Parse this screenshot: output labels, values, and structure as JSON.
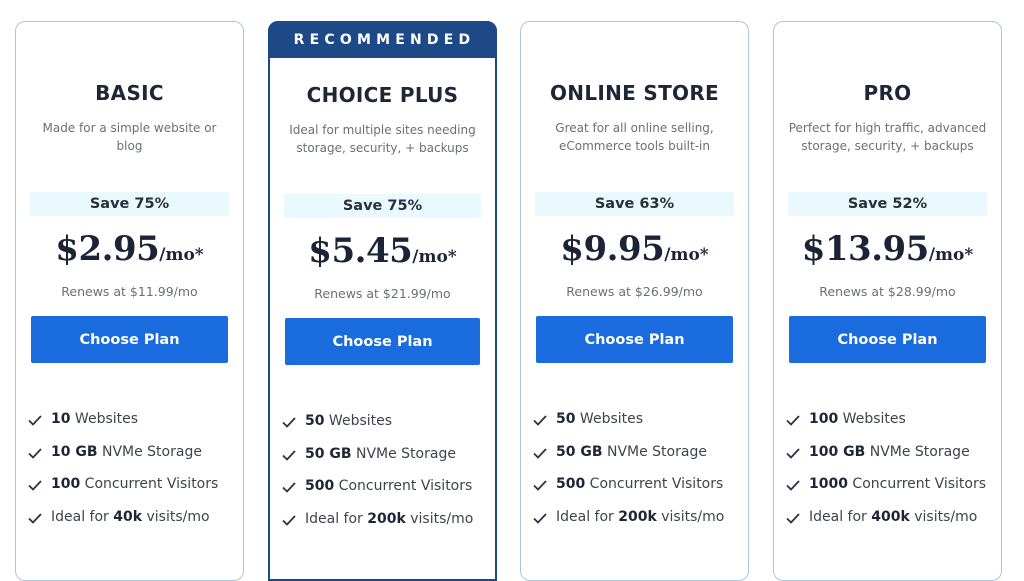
{
  "recommended_label": "RECOMMENDED",
  "plans": [
    {
      "name": "BASIC",
      "description": "Made for a simple website or blog",
      "save": "Save 75%",
      "price": "$2.95",
      "per": "/mo*",
      "renews": "Renews at $11.99/mo",
      "button": "Choose Plan",
      "features": [
        {
          "bold": "10",
          "text": " Websites"
        },
        {
          "bold": "10 GB",
          "text": " NVMe Storage"
        },
        {
          "bold": "100",
          "text": " Concurrent Visitors"
        },
        {
          "pre": "Ideal for ",
          "bold": "40k",
          "text": " visits/mo"
        }
      ]
    },
    {
      "name": "CHOICE PLUS",
      "description": "Ideal for multiple sites needing storage, security, + backups",
      "save": "Save 75%",
      "price": "$5.45",
      "per": "/mo*",
      "renews": "Renews at $21.99/mo",
      "button": "Choose Plan",
      "recommended": true,
      "features": [
        {
          "bold": "50",
          "text": " Websites"
        },
        {
          "bold": "50 GB",
          "text": " NVMe Storage"
        },
        {
          "bold": "500",
          "text": " Concurrent Visitors"
        },
        {
          "pre": "Ideal for ",
          "bold": "200k",
          "text": " visits/mo"
        }
      ]
    },
    {
      "name": "ONLINE STORE",
      "description": "Great for all online selling, eCommerce tools built-in",
      "save": "Save 63%",
      "price": "$9.95",
      "per": "/mo*",
      "renews": "Renews at $26.99/mo",
      "button": "Choose Plan",
      "features": [
        {
          "bold": "50",
          "text": " Websites"
        },
        {
          "bold": "50 GB",
          "text": " NVMe Storage"
        },
        {
          "bold": "500",
          "text": " Concurrent Visitors"
        },
        {
          "pre": "Ideal for ",
          "bold": "200k",
          "text": " visits/mo"
        }
      ]
    },
    {
      "name": "PRO",
      "description": "Perfect for high traffic, advanced storage, security, + backups",
      "save": "Save 52%",
      "price": "$13.95",
      "per": "/mo*",
      "renews": "Renews at $28.99/mo",
      "button": "Choose Plan",
      "features": [
        {
          "bold": "100",
          "text": " Websites"
        },
        {
          "bold": "100 GB",
          "text": " NVMe Storage"
        },
        {
          "bold": "1000",
          "text": " Concurrent Visitors"
        },
        {
          "pre": "Ideal for ",
          "bold": "400k",
          "text": " visits/mo"
        }
      ]
    }
  ],
  "colors": {
    "button": "#196bde",
    "banner": "#1d4a86",
    "save_bg": "#e9f9fd",
    "card_border": "#a9c8df"
  }
}
